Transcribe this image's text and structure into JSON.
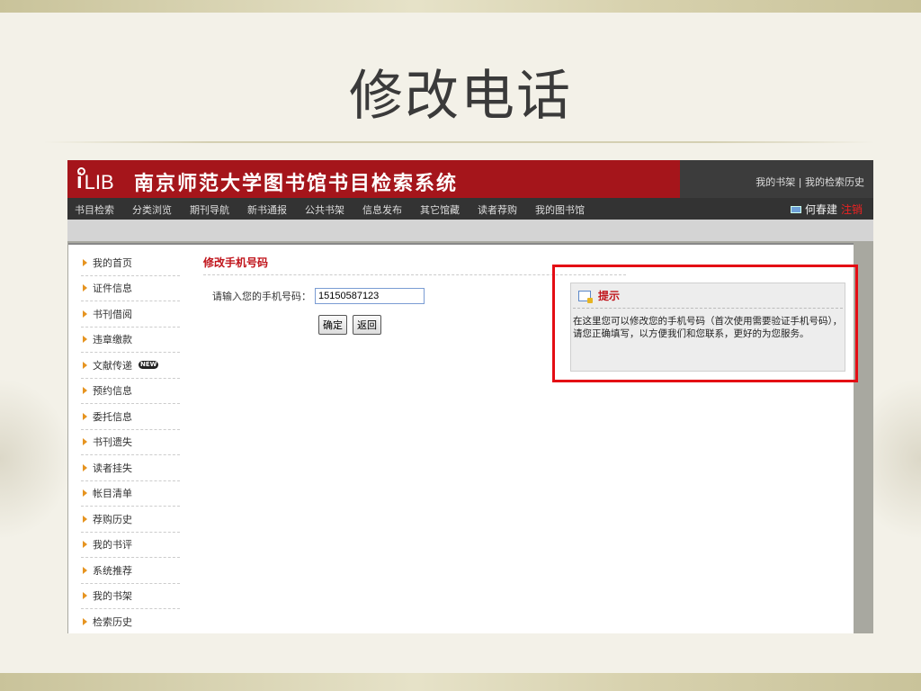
{
  "slide": {
    "title": "修改电话"
  },
  "header": {
    "logo_text": "LIB",
    "system_title": "南京师范大学图书馆书目检索系统",
    "top_links": "我的书架 | 我的检索历史"
  },
  "nav": {
    "items": [
      "书目检索",
      "分类浏览",
      "期刊导航",
      "新书通报",
      "公共书架",
      "信息发布",
      "其它馆藏",
      "读者荐购",
      "我的图书馆"
    ],
    "user_name": "何春建",
    "logout_label": "注销"
  },
  "sidebar": {
    "items": [
      {
        "label": "我的首页"
      },
      {
        "label": "证件信息"
      },
      {
        "label": "书刊借阅"
      },
      {
        "label": "违章缴款"
      },
      {
        "label": "文献传递",
        "badge": "NEW"
      },
      {
        "label": "预约信息"
      },
      {
        "label": "委托信息"
      },
      {
        "label": "书刊遗失"
      },
      {
        "label": "读者挂失"
      },
      {
        "label": "帐目清单"
      },
      {
        "label": "荐购历史"
      },
      {
        "label": "我的书评"
      },
      {
        "label": "系统推荐"
      },
      {
        "label": "我的书架"
      },
      {
        "label": "检索历史"
      }
    ]
  },
  "main": {
    "title": "修改手机号码",
    "phone_label": "请输入您的手机号码：",
    "phone_value": "15150587123",
    "confirm_label": "确定",
    "back_label": "返回"
  },
  "tip": {
    "title": "提示",
    "body": "在这里您可以修改您的手机号码（首次使用需要验证手机号码），请您正确填写，以方便我们和您联系，更好的为您服务。"
  },
  "colors": {
    "brand_red": "#a5151b",
    "accent_red": "#c0141b",
    "highlight_red": "#e40d14"
  }
}
